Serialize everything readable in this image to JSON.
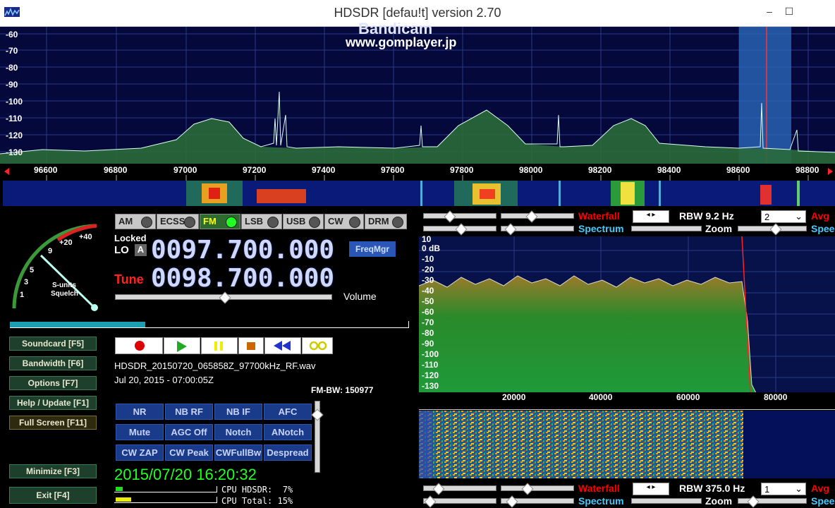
{
  "window": {
    "title": "HDSDR [defau!t]  version 2.70",
    "minimize": "–",
    "maximize": "☐",
    "close": "✕"
  },
  "watermark": {
    "line1": "Bandicam",
    "line2": "www.gomplayer.jp"
  },
  "top_spectrum": {
    "y_labels": [
      "-60",
      "-70",
      "-80",
      "-90",
      "-100",
      "-110",
      "-120",
      "-130"
    ],
    "x_labels": [
      "96600",
      "96800",
      "97000",
      "97200",
      "97400",
      "97600",
      "97800",
      "98000",
      "98200",
      "98400",
      "98600",
      "98800"
    ]
  },
  "smeter": {
    "scale": [
      "1",
      "3",
      "5",
      "9",
      "+20",
      "+40"
    ],
    "label1": "S-units",
    "label2": "Squelch"
  },
  "modes": [
    {
      "label": "AM",
      "active": false
    },
    {
      "label": "ECSS",
      "active": false
    },
    {
      "label": "FM",
      "active": true
    },
    {
      "label": "LSB",
      "active": false
    },
    {
      "label": "USB",
      "active": false
    },
    {
      "label": "CW",
      "active": false
    },
    {
      "label": "DRM",
      "active": false
    }
  ],
  "lo": {
    "status": "Locked",
    "label": "LO",
    "suffix": "A",
    "freq": "0097.700.000"
  },
  "tune": {
    "label": "Tune",
    "freq": "0098.700.000"
  },
  "freqmgr": "FreqMgr",
  "volume": "Volume",
  "left_buttons": [
    {
      "label": "Soundcard",
      "key": "[F5]"
    },
    {
      "label": "Bandwidth",
      "key": "[F6]"
    },
    {
      "label": "Options",
      "key": "[F7]"
    },
    {
      "label": "Help / Update",
      "key": "[F1]"
    },
    {
      "label": "Full Screen",
      "key": "[F11]"
    },
    {
      "label": "Minimize",
      "key": "[F3]"
    },
    {
      "label": "Exit",
      "key": "[F4]"
    }
  ],
  "playback": {
    "filename": "HDSDR_20150720_065858Z_97700kHz_RF.wav",
    "timestamp": "Jul 20, 2015 - 07:00:05Z"
  },
  "fm_bw": "FM-BW: 150977",
  "function_buttons": [
    "NR",
    "NB RF",
    "NB IF",
    "AFC",
    "Mute",
    "AGC Off",
    "Notch",
    "ANotch",
    "CW ZAP",
    "CW Peak",
    "CWFullBw",
    "Despread"
  ],
  "clock": "2015/07/20 16:20:32",
  "cpu": {
    "hdsdr": "CPU HDSDR:  7%",
    "total": "CPU Total: 15%"
  },
  "upper_ctrl": {
    "waterfall": "Waterfall",
    "spectrum": "Spectrum",
    "rbw": "RBW  9.2 Hz",
    "zoom": "Zoom",
    "select": "2",
    "avg": "Avg",
    "speed": "Spee"
  },
  "lower_ctrl": {
    "waterfall": "Waterfall",
    "spectrum": "Spectrum",
    "rbw": "RBW 375.0 Hz",
    "zoom": "Zoom",
    "select": "1",
    "avg": "Avg",
    "speed": "Spee"
  },
  "af_spectrum": {
    "y_labels": [
      "10",
      "0 dB",
      "-10",
      "-20",
      "-30",
      "-40",
      "-50",
      "-60",
      "-70",
      "-80",
      "-90",
      "-100",
      "-110",
      "-120",
      "-130"
    ],
    "x_labels": [
      "20000",
      "40000",
      "60000",
      "80000"
    ]
  },
  "colors": {
    "accent": "#2f56b0",
    "green_spec": "#2a7a3a",
    "red": "#ff0000",
    "cyan": "#44ccff"
  }
}
